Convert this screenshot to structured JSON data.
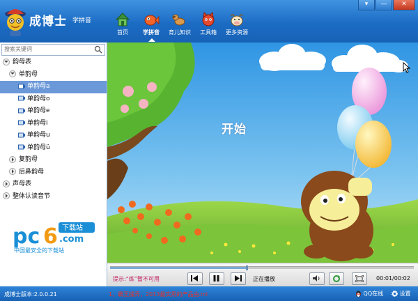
{
  "window": {
    "title": "成博士",
    "subtitle": "学拼音",
    "controls": {
      "menu": "▾",
      "minimize": "—",
      "close": "✕"
    }
  },
  "nav": [
    {
      "label": "首页",
      "icon": "home-icon"
    },
    {
      "label": "学拼音",
      "icon": "fish-icon",
      "active": true
    },
    {
      "label": "育儿知识",
      "icon": "dog-icon"
    },
    {
      "label": "工具箱",
      "icon": "cat-icon"
    },
    {
      "label": "更多资源",
      "icon": "cow-icon"
    }
  ],
  "sidebar": {
    "search_placeholder": "搜索关键词",
    "tree": [
      {
        "label": "韵母表",
        "level": 0,
        "toggle": "open"
      },
      {
        "label": "单韵母",
        "level": 1,
        "toggle": "open"
      },
      {
        "label": "单韵母a",
        "level": 2,
        "selected": true
      },
      {
        "label": "单韵母o",
        "level": 2
      },
      {
        "label": "单韵母e",
        "level": 2
      },
      {
        "label": "单韵母i",
        "level": 2
      },
      {
        "label": "单韵母u",
        "level": 2
      },
      {
        "label": "单韵母ü",
        "level": 2
      },
      {
        "label": "复韵母",
        "level": 1,
        "toggle": "closed"
      },
      {
        "label": "后鼻韵母",
        "level": 1,
        "toggle": "closed"
      },
      {
        "label": "声母表",
        "level": 0,
        "toggle": "closed"
      },
      {
        "label": "整体认读音节",
        "level": 0,
        "toggle": "closed"
      }
    ],
    "watermark": {
      "brand": "pc6",
      "badge": "下载站",
      "domain": ".com",
      "tagline": "中国最安全的下载站"
    }
  },
  "stage": {
    "start_label": "开始"
  },
  "player": {
    "hint": "提示:“练”暂不可用",
    "status": "正在播放",
    "time": "00:01/00:02",
    "progress": 0.45
  },
  "statusbar": {
    "version": "成博士版本:2.0.0.21",
    "marquee": "1、霸王操弄，2013最实用的产品由.ml",
    "qq": "QQ在线",
    "settings": "设置"
  },
  "colors": {
    "titlebar": "#1c6cc4",
    "sky": "#39a2e8",
    "grass": "#7dc23a",
    "selection": "#6b98d9",
    "hint": "#c1195e"
  }
}
